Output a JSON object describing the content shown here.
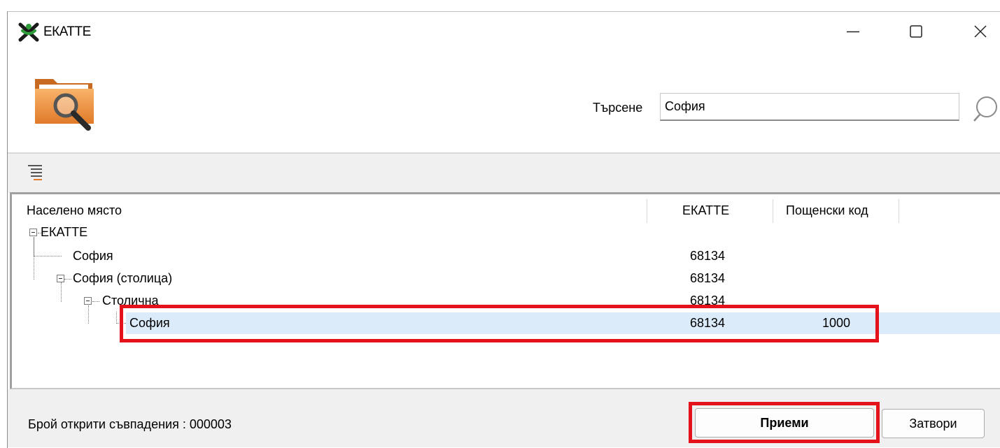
{
  "window": {
    "title": "ЕКАТТЕ",
    "app_icon": "ekatte-logo-icon",
    "minimize_icon": "minimize-icon",
    "maximize_icon": "maximize-icon",
    "close_icon": "close-icon"
  },
  "header": {
    "folder_icon": "folder-search-icon",
    "search_label": "Търсене",
    "search_value": "София",
    "search_icon": "search-icon"
  },
  "toolbar": {
    "collapse_icon": "collapse-all-icon"
  },
  "tree": {
    "columns": [
      "Населено място",
      "ЕКАТТЕ",
      "Пощенски код"
    ],
    "rows": [
      {
        "name": "ЕКАТТЕ",
        "ekatte": "",
        "postal": ""
      },
      {
        "name": "София",
        "ekatte": "68134",
        "postal": ""
      },
      {
        "name": "София (столица)",
        "ekatte": "68134",
        "postal": ""
      },
      {
        "name": "Столична",
        "ekatte": "68134",
        "postal": ""
      },
      {
        "name": "София",
        "ekatte": "68134",
        "postal": "1000"
      }
    ]
  },
  "footer": {
    "matches_text": "Брой открити съвпадения : 000003",
    "accept_label": "Приеми",
    "close_label": "Затвори"
  },
  "colors": {
    "highlight_border": "#e4121b",
    "selection": "#dcebfa"
  }
}
